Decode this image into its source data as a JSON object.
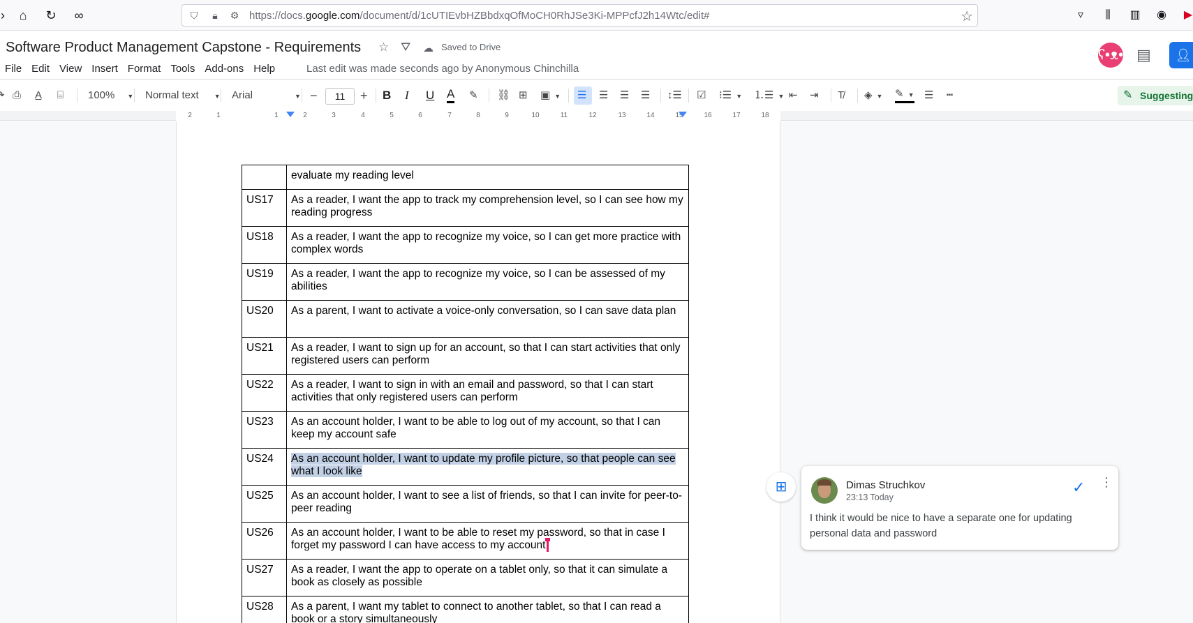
{
  "browser": {
    "url_prefix": "https://docs.",
    "url_domain": "google.com",
    "url_path": "/document/d/1cUTIEvbHZBbdxqOfMoCH0RhJSe3Ki-MPPcfJ2h14Wtc/edit#"
  },
  "doc": {
    "title": "Software Product Management Capstone - Requirements",
    "saved_status": "Saved to Drive",
    "last_edit": "Last edit was made seconds ago by Anonymous Chinchilla"
  },
  "menu": [
    "File",
    "Edit",
    "View",
    "Insert",
    "Format",
    "Tools",
    "Add-ons",
    "Help"
  ],
  "toolbar": {
    "zoom": "100%",
    "style": "Normal text",
    "font": "Arial",
    "font_size": "11",
    "mode": "Suggesting"
  },
  "ruler": {
    "ticks": [
      "2",
      "1",
      "1",
      "2",
      "3",
      "4",
      "5",
      "6",
      "7",
      "8",
      "9",
      "10",
      "11",
      "12",
      "13",
      "14",
      "15",
      "16",
      "17",
      "18"
    ]
  },
  "table": {
    "rows": [
      {
        "id": "",
        "text": "evaluate my reading level"
      },
      {
        "id": "US17",
        "text": "As a reader, I want the app to track my comprehension level, so I can see how my reading progress"
      },
      {
        "id": "US18",
        "text": "As a reader, I want the app to recognize my voice, so I can get more practice with complex words"
      },
      {
        "id": "US19",
        "text": "As a reader, I want the app to recognize my voice, so I can be assessed of my abilities"
      },
      {
        "id": "US20",
        "text": "As a parent, I want to activate a voice-only conversation, so I can save data plan"
      },
      {
        "id": "US21",
        "text": "As a reader, I want to sign up for  an account, so that I can start activities that only registered users can perform"
      },
      {
        "id": "US22",
        "text": "As a reader, I want to sign in with an email and password, so that I can start activities that only registered users can perform"
      },
      {
        "id": "US23",
        "text": "As an account holder, I want to be able to log out of my account, so that I can keep my account safe"
      },
      {
        "id": "US24",
        "text": "As an account holder, I want to update my profile picture, so that people can see what I look like"
      },
      {
        "id": "US25",
        "text": "As an account holder, I want to see a list of friends, so that I can invite for peer-to-peer reading"
      },
      {
        "id": "US26",
        "text": "As an account holder, I want to be able to reset my password, so that in case I forget my password I can have access to my account"
      },
      {
        "id": "US27",
        "text": "As a reader, I want the app to operate on a tablet only, so that it can simulate a book as closely as possible"
      },
      {
        "id": "US28",
        "text": "As a parent, I want my tablet to connect to another tablet, so that I can read a book or a story simultaneously"
      }
    ]
  },
  "comment": {
    "author": "Dimas Struchkov",
    "time": "23:13 Today",
    "text": "I think it would be nice to have a separate one for updating personal data and password"
  },
  "colors": {
    "accent": "#1a73e8",
    "suggesting_bg": "#e6f4ea",
    "suggesting_fg": "#137333",
    "highlight": "#c2d0e5",
    "cursor": "#e8176b"
  }
}
